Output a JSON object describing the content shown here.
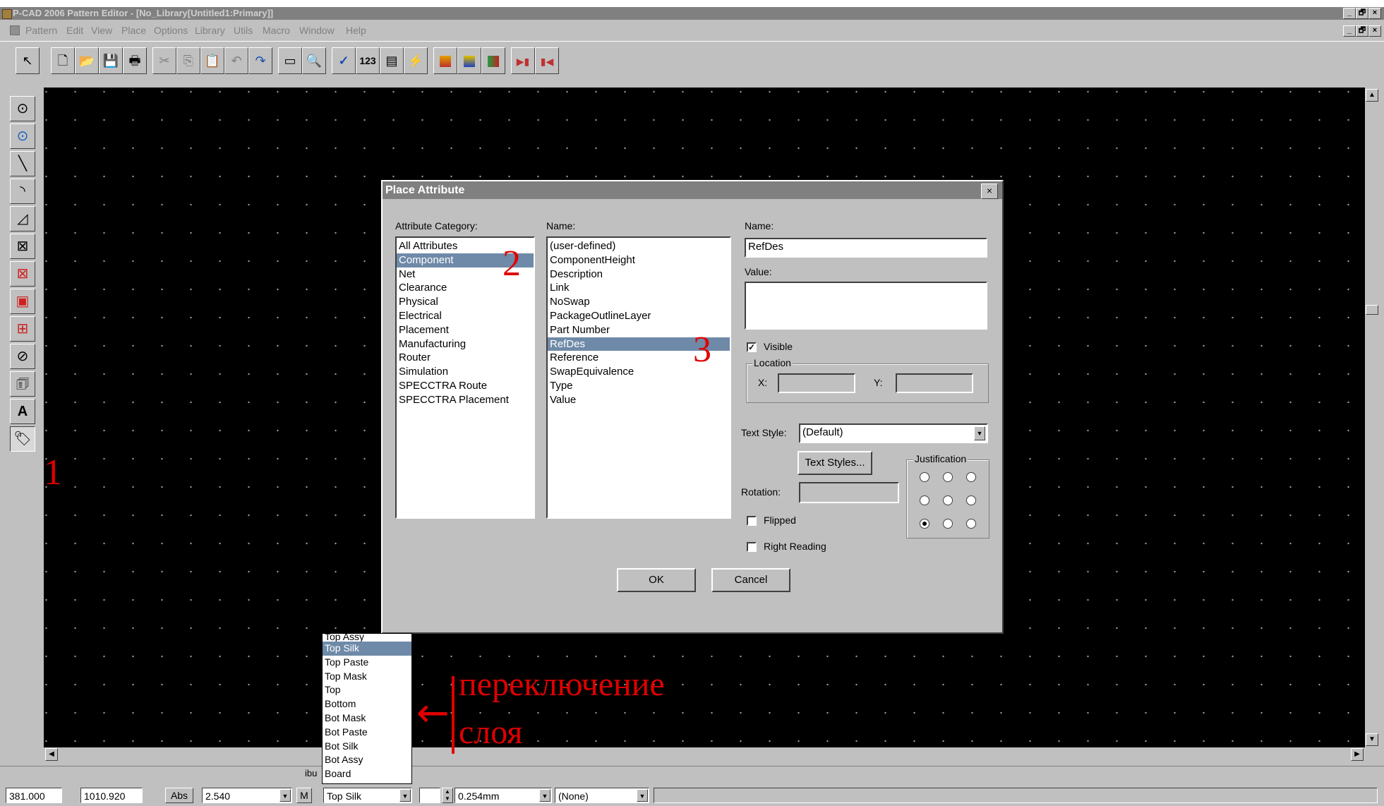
{
  "window": {
    "title": "P-CAD 2006 Pattern Editor - [No_Library[Untitled1:Primary]]",
    "min_label": "_",
    "max_label": "🗗",
    "close_label": "×"
  },
  "menu": [
    "Pattern",
    "Edit",
    "View",
    "Place",
    "Options",
    "Library",
    "Utils",
    "Macro",
    "Window",
    "Help"
  ],
  "toolbar": {
    "select_glyph": "↖",
    "new_glyph": "🗋",
    "open_glyph": "📂",
    "save_glyph": "💾",
    "print_glyph": "🖶",
    "cut_glyph": "✂",
    "copy_glyph": "⎘",
    "paste_glyph": "📋",
    "undo_glyph": "↶",
    "redo_glyph": "↷",
    "measure_glyph": "▭",
    "zoom_glyph": "🔍",
    "check_glyph": "✓",
    "num_label": "123",
    "rules_glyph": "▤",
    "power_glyph": "⚡"
  },
  "dialog": {
    "title": "Place Attribute",
    "close_label": "×",
    "category_label": "Attribute Category:",
    "categories": [
      "All Attributes",
      "Component",
      "Net",
      "Clearance",
      "Physical",
      "Electrical",
      "Placement",
      "Manufacturing",
      "Router",
      "Simulation",
      "SPECCTRA Route",
      "SPECCTRA Placement"
    ],
    "selected_category": "Component",
    "names_label": "Name:",
    "names": [
      "(user-defined)",
      "ComponentHeight",
      "Description",
      "Link",
      "NoSwap",
      "PackageOutlineLayer",
      "Part Number",
      "RefDes",
      "Reference",
      "SwapEquivalence",
      "Type",
      "Value"
    ],
    "selected_name": "RefDes",
    "name_field_label": "Name:",
    "name_field_value": "RefDes",
    "value_field_label": "Value:",
    "value_field_value": "",
    "visible_label": "Visible",
    "visible_checked": true,
    "location_label": "Location",
    "x_label": "X:",
    "y_label": "Y:",
    "text_style_label": "Text Style:",
    "text_style_value": "(Default)",
    "text_styles_button": "Text Styles...",
    "justification_label": "Justification",
    "justification_selected": "bottom-left",
    "rotation_label": "Rotation:",
    "flipped_label": "Flipped",
    "right_reading_label": "Right Reading",
    "ok_label": "OK",
    "cancel_label": "Cancel"
  },
  "layer_dropdown": {
    "items": [
      "Top Assy",
      "Top Silk",
      "Top Paste",
      "Top Mask",
      "Top",
      "Bottom",
      "Bot Mask",
      "Bot Paste",
      "Bot Silk",
      "Bot Assy",
      "Board"
    ],
    "selected": "Top Silk"
  },
  "status": {
    "partial_label": "ibu",
    "x_coord": "381.000",
    "y_coord": "1010.920",
    "abs_label": "Abs",
    "grid_value": "2.540",
    "m_label": "M",
    "layer_value": "Top Silk",
    "line_width": "0.254mm",
    "none_value": "(None)"
  },
  "annotations": {
    "marker_1": "1",
    "marker_2": "2",
    "marker_3": "3",
    "layer_switch_line1": "переключение",
    "layer_switch_line2": "слоя",
    "arrow": "←"
  },
  "colors": {
    "canvas": "#000000",
    "selection": "#6f8aa8",
    "annotation": "#e00000"
  }
}
